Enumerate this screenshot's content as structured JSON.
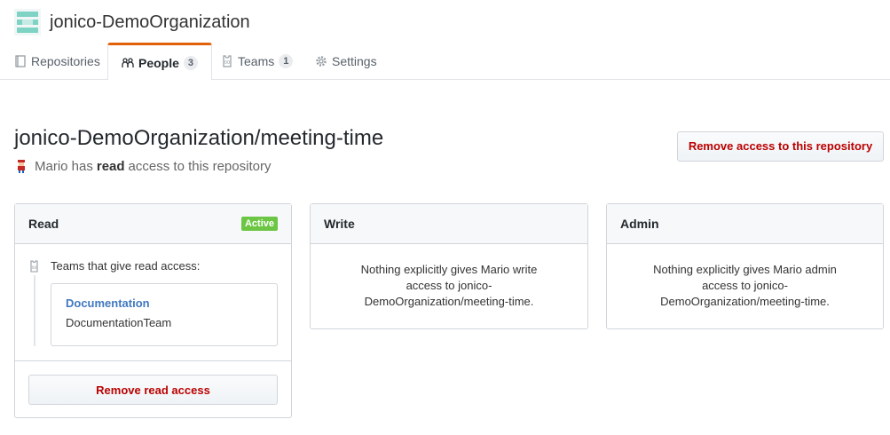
{
  "org": {
    "name": "jonico-DemoOrganization",
    "avatar_icon": "org-identicon"
  },
  "tabs": [
    {
      "label": "Repositories",
      "icon": "repo-icon",
      "count": null,
      "selected": false
    },
    {
      "label": "People",
      "icon": "people-icon",
      "count": "3",
      "selected": true
    },
    {
      "label": "Teams",
      "icon": "jersey-icon",
      "count": "1",
      "selected": false
    },
    {
      "label": "Settings",
      "icon": "gear-icon",
      "count": null,
      "selected": false
    }
  ],
  "repo": {
    "full_name": "jonico-DemoOrganization/meeting-time",
    "access_prefix": "Mario has",
    "access_level": "read",
    "access_suffix": "access to this repository",
    "remove_button": "Remove access to this repository"
  },
  "panels": {
    "read": {
      "title": "Read",
      "badge": "Active",
      "teams_label": "Teams that give read access:",
      "team": {
        "name": "Documentation",
        "description": "DocumentationTeam"
      },
      "remove_button": "Remove read access"
    },
    "write": {
      "title": "Write",
      "message": "Nothing explicitly gives Mario write access to jonico-DemoOrganization/meeting-time."
    },
    "admin": {
      "title": "Admin",
      "message": "Nothing explicitly gives Mario admin access to jonico-DemoOrganization/meeting-time."
    }
  },
  "colors": {
    "accent_tab": "#e36209",
    "danger": "#bb0000",
    "active_badge": "#6cc644",
    "link": "#4078c0"
  }
}
